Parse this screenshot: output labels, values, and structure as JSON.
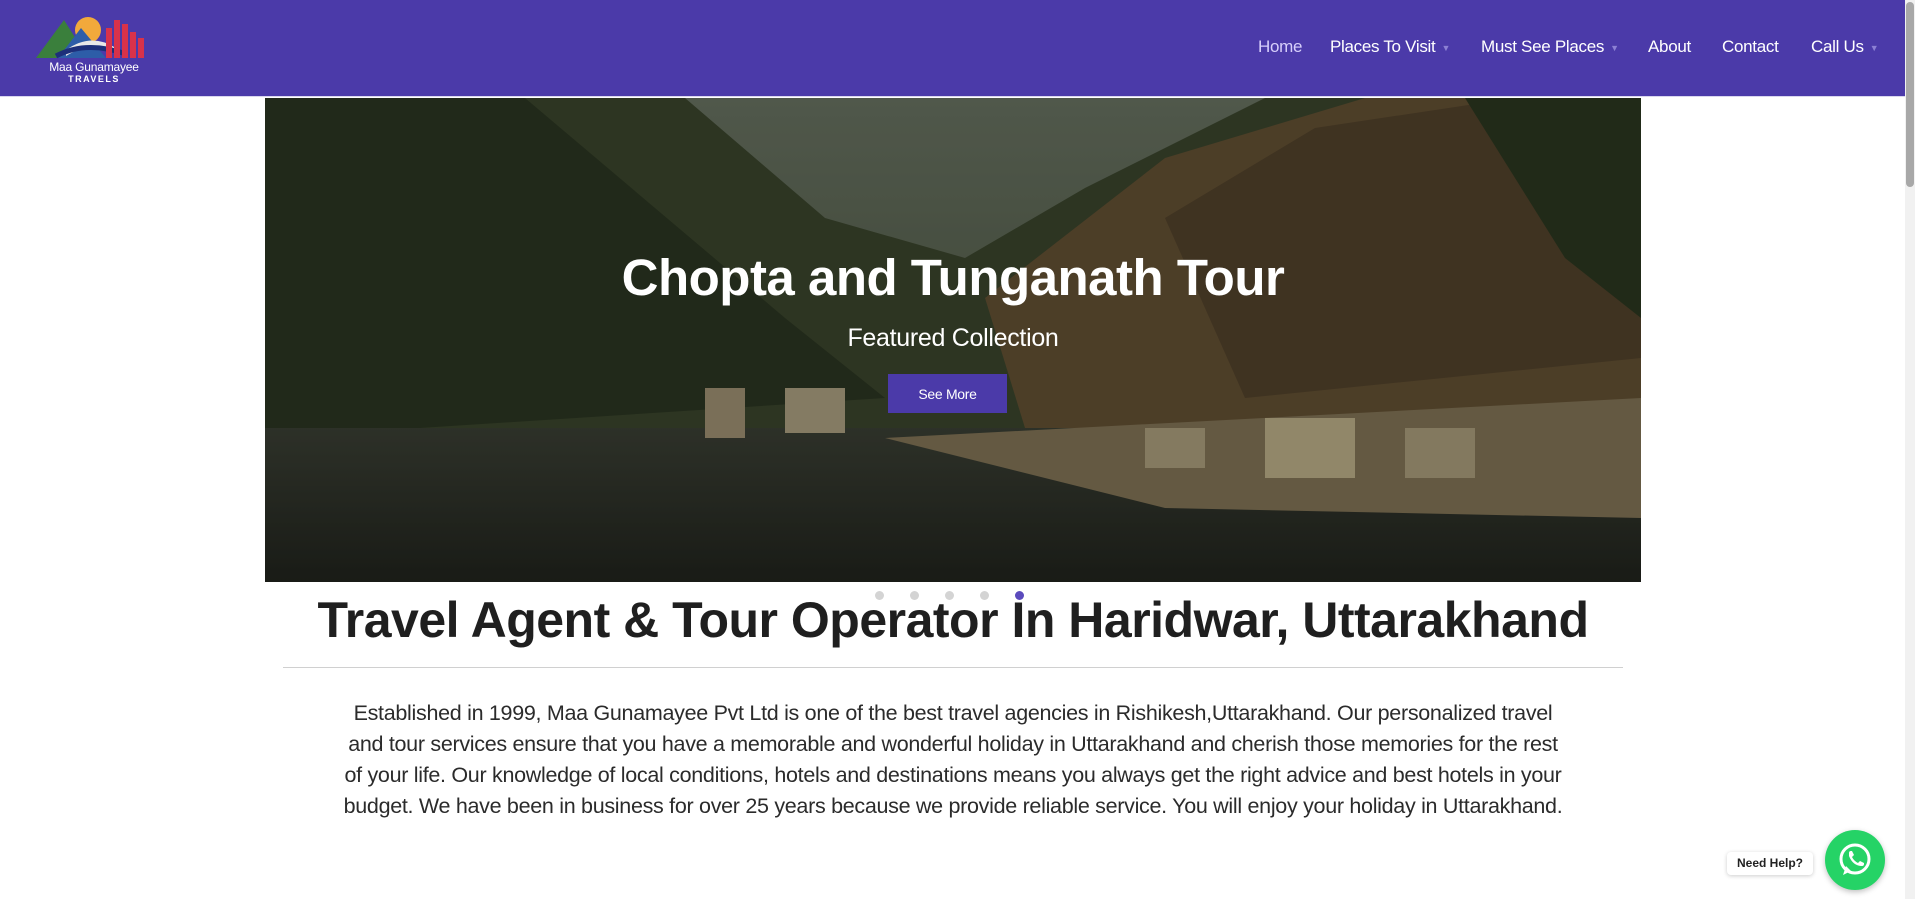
{
  "brand": {
    "name_line1": "Maa Gunamayee",
    "name_line2": "TRAVELS",
    "primary_color": "#4b3aa9"
  },
  "nav": {
    "items": [
      {
        "label": "Home",
        "active": true
      },
      {
        "label": "Places To Visit",
        "dropdown": true
      },
      {
        "label": "Must See Places",
        "dropdown": true
      },
      {
        "label": "About"
      },
      {
        "label": "Contact"
      },
      {
        "label": "Call Us",
        "dropdown": true
      }
    ]
  },
  "hero": {
    "title": "Chopta and Tunganath Tour",
    "subtitle": "Featured Collection",
    "button_label": "See More",
    "slide_count": 5,
    "active_slide": 5
  },
  "content": {
    "heading": "Travel Agent & Tour Operator In Haridwar, Uttarakhand",
    "intro": "Established in 1999, Maa Gunamayee Pvt Ltd is one of the best travel agencies in Rishikesh,Uttarakhand. Our personalized travel and tour services ensure that you have a memorable and wonderful holiday in Uttarakhand and cherish those memories for the rest of your life. Our knowledge of local conditions, hotels and destinations means you always get the right advice and best hotels in your budget. We have been in business for over 25 years because we provide reliable service. You will enjoy your holiday in Uttarakhand."
  },
  "help_widget": {
    "label": "Need Help?",
    "icon": "whatsapp-icon",
    "color": "#25d366"
  }
}
